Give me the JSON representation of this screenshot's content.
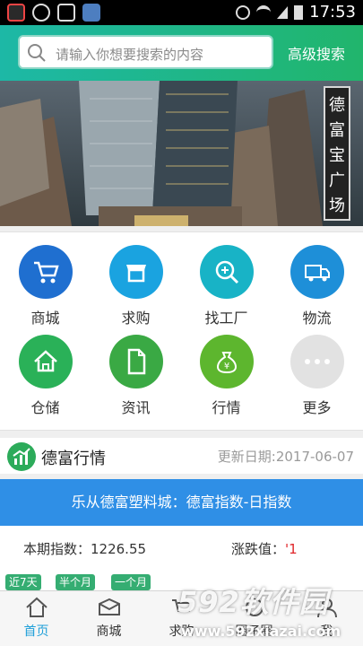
{
  "statusbar": {
    "time": "17:53"
  },
  "search": {
    "placeholder": "请输入你想要搜索的内容",
    "advanced_label": "高级搜索"
  },
  "banner": {
    "tag_chars": [
      "德",
      "富",
      "宝",
      "广",
      "场"
    ]
  },
  "categories": [
    {
      "label": "商城",
      "icon": "cart-icon",
      "color": "#1f6fd0"
    },
    {
      "label": "求购",
      "icon": "shop-icon",
      "color": "#1aa3e0"
    },
    {
      "label": "找工厂",
      "icon": "zoom-in-icon",
      "color": "#18b3c6"
    },
    {
      "label": "物流",
      "icon": "truck-icon",
      "color": "#1e8fd8"
    },
    {
      "label": "仓储",
      "icon": "home-icon",
      "color": "#2ab158"
    },
    {
      "label": "资讯",
      "icon": "document-icon",
      "color": "#3aa944"
    },
    {
      "label": "行情",
      "icon": "money-bag-icon",
      "color": "#5db62e"
    },
    {
      "label": "更多",
      "icon": "more-icon",
      "color": "#e2e2e2"
    }
  ],
  "market": {
    "title": "德富行情",
    "update_date": "更新日期:2017-06-07",
    "banner_text": "乐从德富塑料城：德富指数-日指数",
    "index_text": "本期指数：1226.55",
    "change_label": "涨跌值：",
    "change_value": "'1",
    "range_tabs": [
      "近7天",
      "半个月",
      "一个月"
    ]
  },
  "nav": {
    "tabs": [
      {
        "label": "首页",
        "icon": "home-icon",
        "active": true
      },
      {
        "label": "商城",
        "icon": "box-icon",
        "active": false
      },
      {
        "label": "求购",
        "icon": "cart-icon",
        "active": false
      },
      {
        "label": "圈子圈",
        "icon": "circle-icon",
        "active": false
      },
      {
        "label": "我",
        "icon": "user-icon",
        "active": false
      }
    ]
  },
  "watermark": {
    "brand": "592软件园",
    "url": "www.592xiazai.com"
  },
  "colors": {
    "accent": "#1db8a6",
    "blue_bar": "#2f8fe6",
    "green": "#2cab5a",
    "red": "#e0262a"
  }
}
